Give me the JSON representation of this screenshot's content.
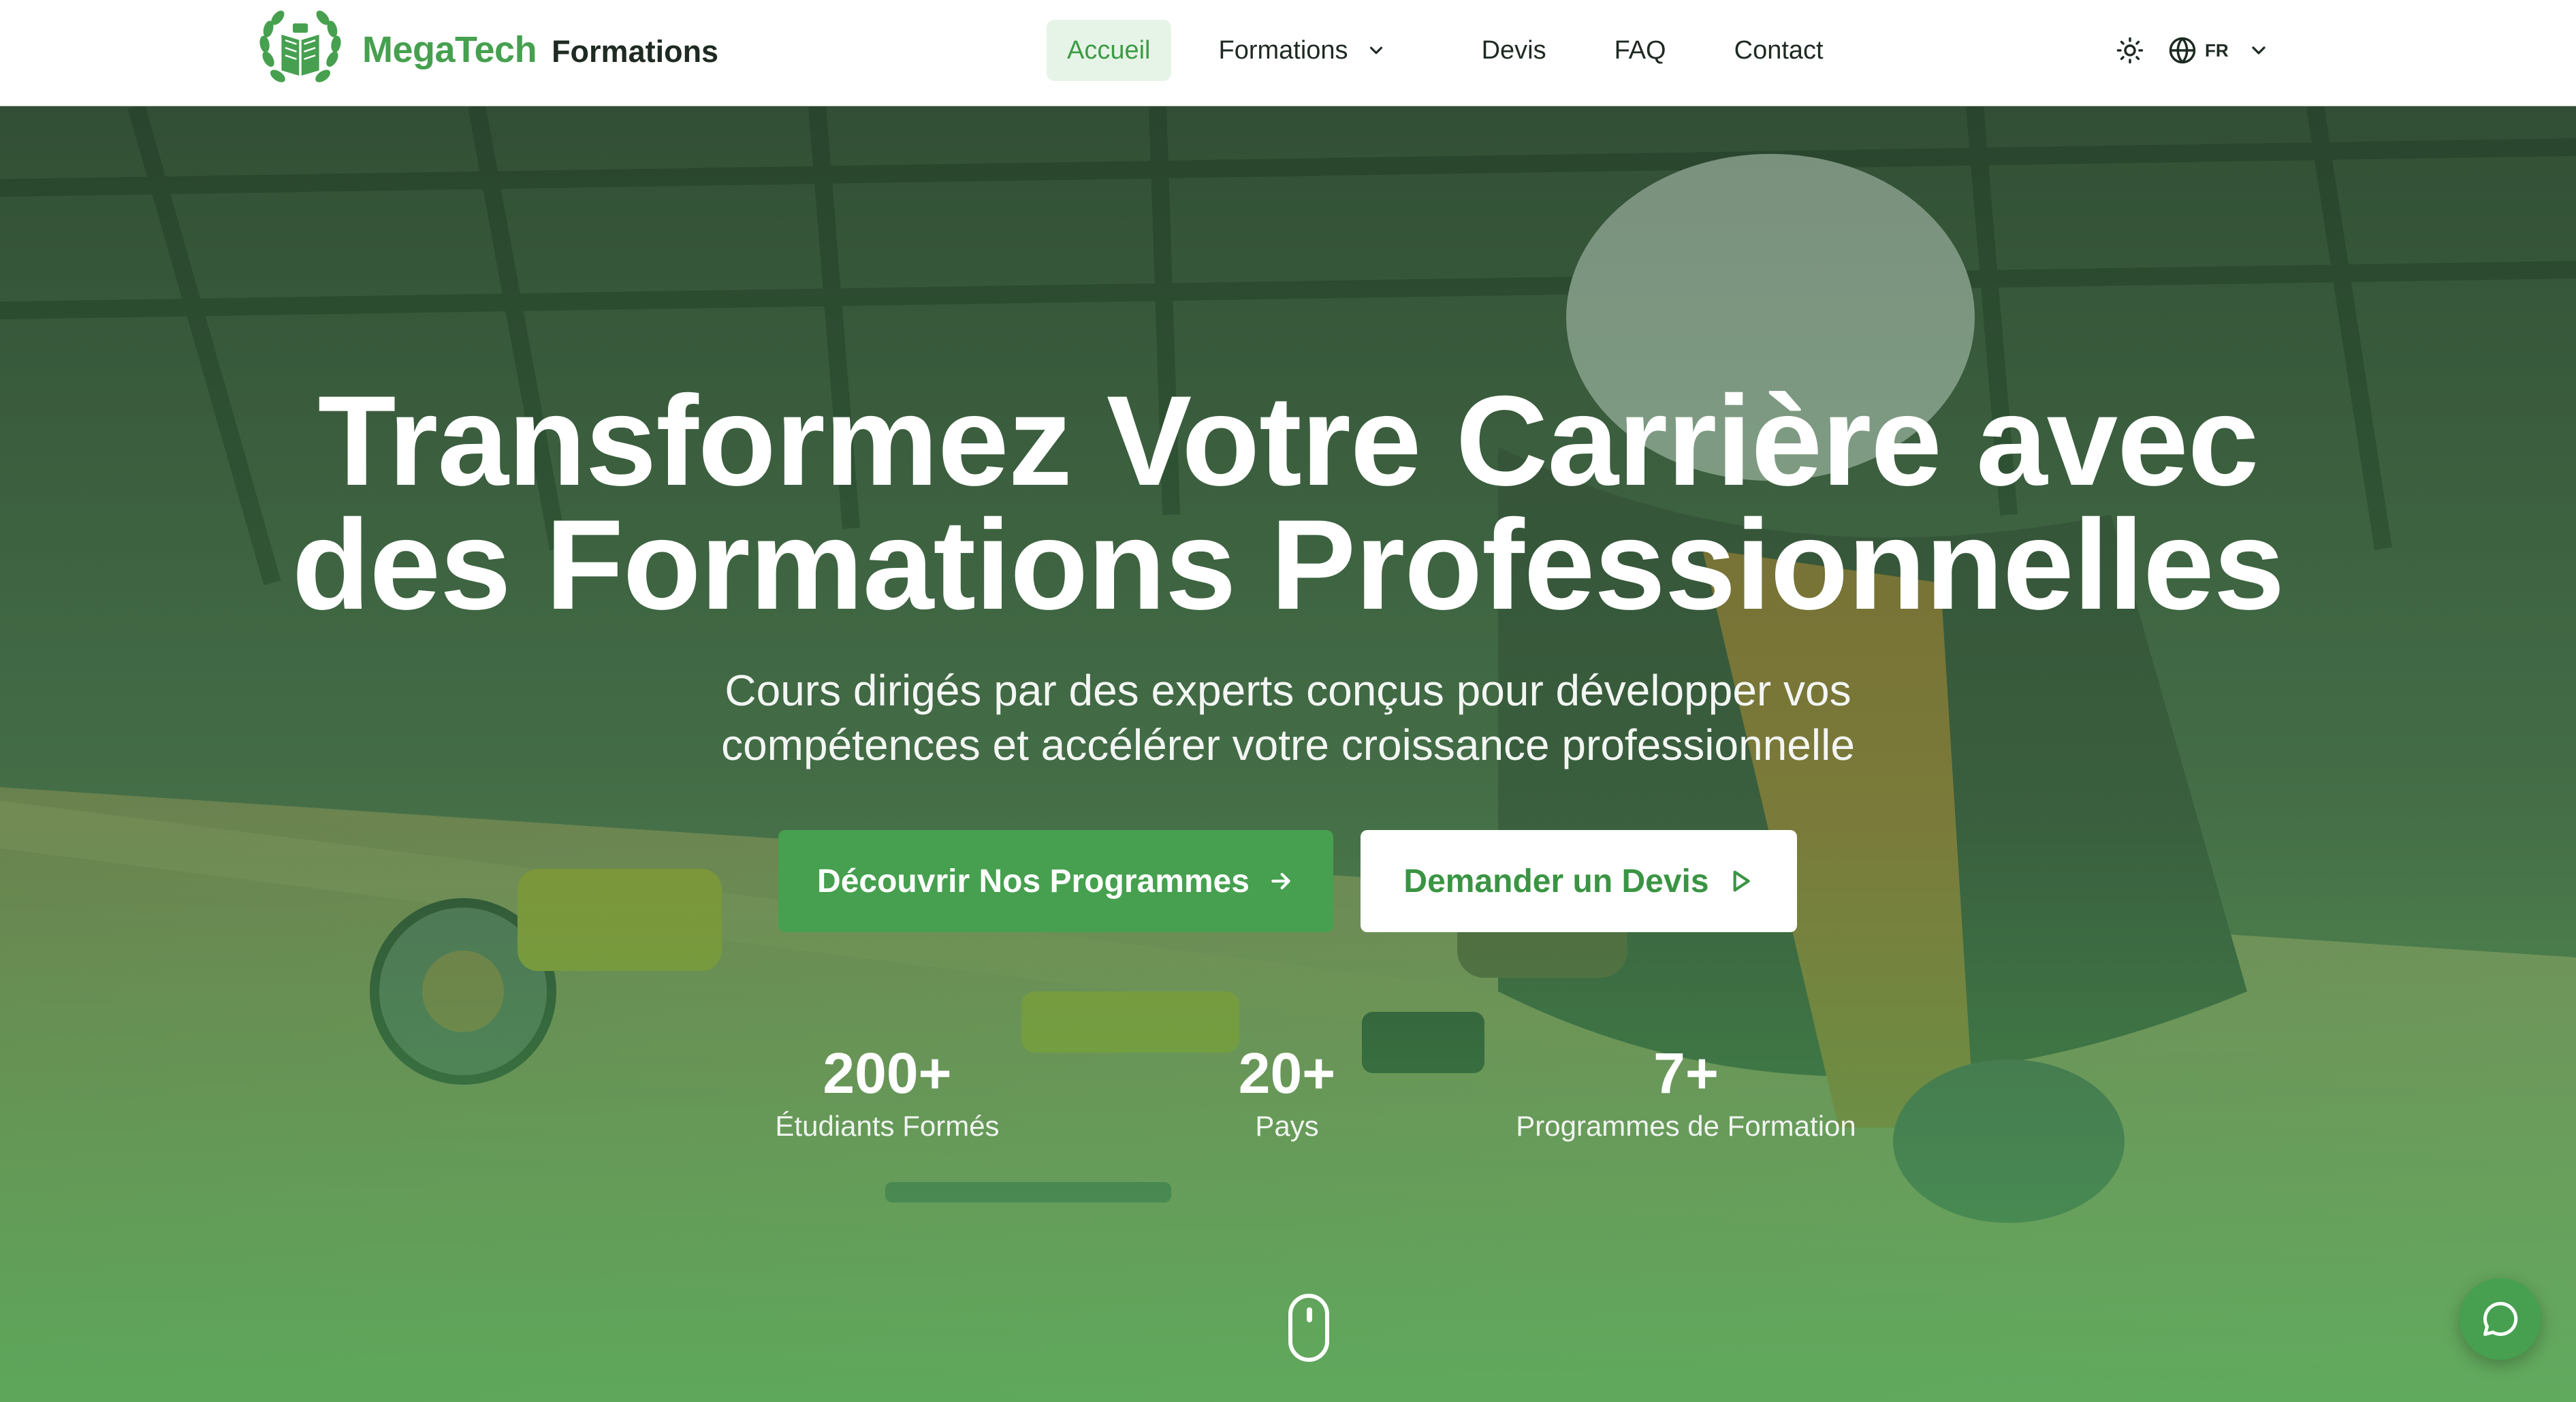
{
  "brand": {
    "name": "MegaTech",
    "sub": "Formations",
    "logo_icon": "book-laurel-icon",
    "accent_color": "#46a04f"
  },
  "nav": {
    "items": [
      {
        "label": "Accueil",
        "active": true
      },
      {
        "label": "Formations",
        "dropdown": true
      },
      {
        "label": "Devis"
      },
      {
        "label": "FAQ"
      },
      {
        "label": "Contact"
      }
    ]
  },
  "tools": {
    "theme_icon": "sun-icon",
    "language_icon": "globe-icon",
    "language_code": "FR"
  },
  "hero": {
    "title_line1": "Transformez Votre Carrière avec",
    "title_line2": "des Formations Professionnelles",
    "subtitle_line1": "Cours dirigés par des experts conçus pour développer vos",
    "subtitle_line2": "compétences et accélérer votre croissance professionnelle",
    "primary_cta": "Découvrir Nos Programmes",
    "secondary_cta": "Demander un Devis",
    "stats": [
      {
        "value": "200+",
        "label": "Étudiants Formés"
      },
      {
        "value": "20+",
        "label": "Pays"
      },
      {
        "value": "7+",
        "label": "Programmes de Formation"
      }
    ]
  },
  "chat": {
    "icon": "chat-bubble-icon"
  }
}
